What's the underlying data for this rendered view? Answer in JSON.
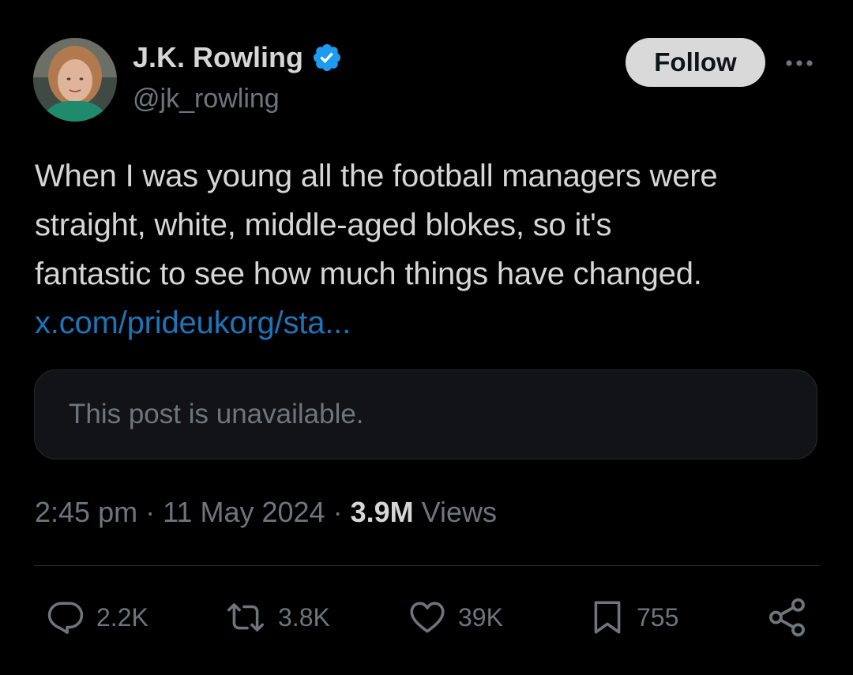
{
  "author": {
    "display_name": "J.K. Rowling",
    "handle": "@jk_rowling"
  },
  "follow_label": "Follow",
  "tweet": {
    "lines": [
      "When I was young all the football managers were",
      "straight, white, middle-aged blokes, so it's",
      "fantastic to see how much things have changed."
    ],
    "link_text": "x.com/prideukorg/sta..."
  },
  "quoted_post": {
    "text": "This post is unavailable."
  },
  "meta": {
    "time": "2:45 pm",
    "date": "11 May 2024",
    "views_count": "3.9M",
    "views_label": "Views",
    "separator": "·"
  },
  "actions": {
    "replies": "2.2K",
    "reposts": "3.8K",
    "likes": "39K",
    "bookmarks": "755"
  },
  "colors": {
    "background": "#000000",
    "verified": "#1d9bf0",
    "link": "#1d74b8",
    "muted": "#6f757a",
    "text": "#d6d6d6"
  },
  "icons": {
    "more": "ellipsis-icon",
    "reply": "reply-icon",
    "repost": "repost-icon",
    "like": "heart-icon",
    "bookmark": "bookmark-icon",
    "share": "share-icon",
    "verified": "verified-badge-icon"
  }
}
